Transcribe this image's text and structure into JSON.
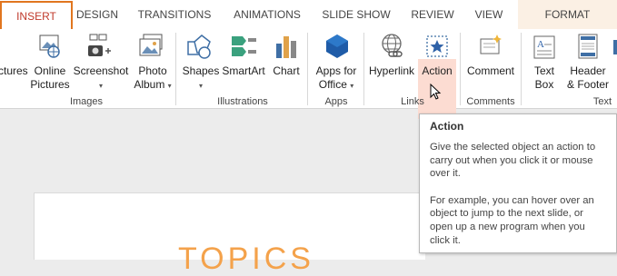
{
  "tabs": [
    {
      "label": "INSERT",
      "active": true
    },
    {
      "label": "DESIGN"
    },
    {
      "label": "TRANSITIONS"
    },
    {
      "label": "ANIMATIONS"
    },
    {
      "label": "SLIDE SHOW"
    },
    {
      "label": "REVIEW"
    },
    {
      "label": "VIEW"
    },
    {
      "label": "FORMAT",
      "contextual": true
    }
  ],
  "ribbon": {
    "images": {
      "label": "Images",
      "pictures": {
        "line1": "ctures"
      },
      "online_pictures": {
        "line1": "Online",
        "line2": "Pictures"
      },
      "screenshot": {
        "line1": "Screenshot",
        "dropdown": "▾"
      },
      "photo_album": {
        "line1": "Photo",
        "line2": "Album",
        "dropdown": "▾"
      }
    },
    "illustrations": {
      "label": "Illustrations",
      "shapes": {
        "line1": "Shapes",
        "dropdown": "▾"
      },
      "smartart": {
        "line1": "SmartArt"
      },
      "chart": {
        "line1": "Chart"
      }
    },
    "apps": {
      "label": "Apps",
      "apps_for_office": {
        "line1": "Apps for",
        "line2": "Office",
        "dropdown": "▾"
      }
    },
    "links": {
      "label": "Links",
      "hyperlink": {
        "line1": "Hyperlink"
      },
      "action": {
        "line1": "Action"
      }
    },
    "comments": {
      "label": "Comments",
      "comment": {
        "line1": "Comment"
      }
    },
    "text": {
      "label": "Text",
      "text_box": {
        "line1": "Text",
        "line2": "Box"
      },
      "header_footer": {
        "line1": "Header",
        "line2": "& Footer"
      }
    }
  },
  "tooltip": {
    "title": "Action",
    "paragraph1": "Give the selected object an action to carry out when you click it or mouse over it.",
    "paragraph2": "For example, you can hover over an object to jump to the next slide, or open up a new program when you click it."
  },
  "slide": {
    "title_fragment": "TOPICS"
  },
  "colors": {
    "accent_tab": "#c0392b",
    "tab_border": "#e1761f",
    "hover": "#fcdcd2",
    "slide_title": "#f4a24b"
  }
}
